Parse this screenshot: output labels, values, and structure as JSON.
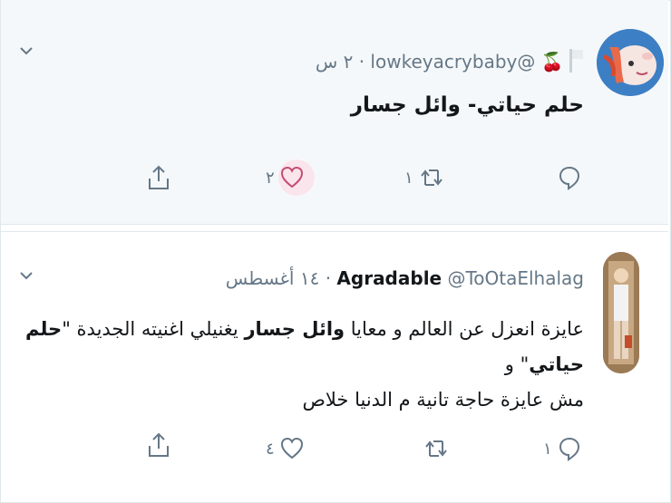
{
  "tweets": [
    {
      "display_name": "",
      "emoji": "🍒",
      "handle": "@lowkeyacrybaby",
      "separator": "·",
      "time": "٢ س",
      "text": "حلم حياتي- وائل جسار",
      "actions": {
        "reply_count": "",
        "retweet_count": "١",
        "like_count": "٢",
        "liked": true
      }
    },
    {
      "display_name": "Agradable",
      "handle": "@ToOtaElhalag",
      "separator": "·",
      "time": "١٤ أغسطس",
      "text_parts": {
        "p1": "عايزة انعزل عن العالم و معايا ",
        "b1": "وائل جسار",
        "p2": " يغنيلي اغنيته الجديدة \"",
        "b2": "حلم حياتي",
        "p3": "\" و",
        "line2": "مش عايزة حاجة تانية م الدنيا خلاص"
      },
      "actions": {
        "reply_count": "١",
        "retweet_count": "",
        "like_count": "٤",
        "liked": false
      }
    }
  ],
  "colors": {
    "accent_like": "#e0245e",
    "icon_gray": "#657786",
    "bg_highlight": "#f5f8fa",
    "border": "#e1e8ed"
  }
}
